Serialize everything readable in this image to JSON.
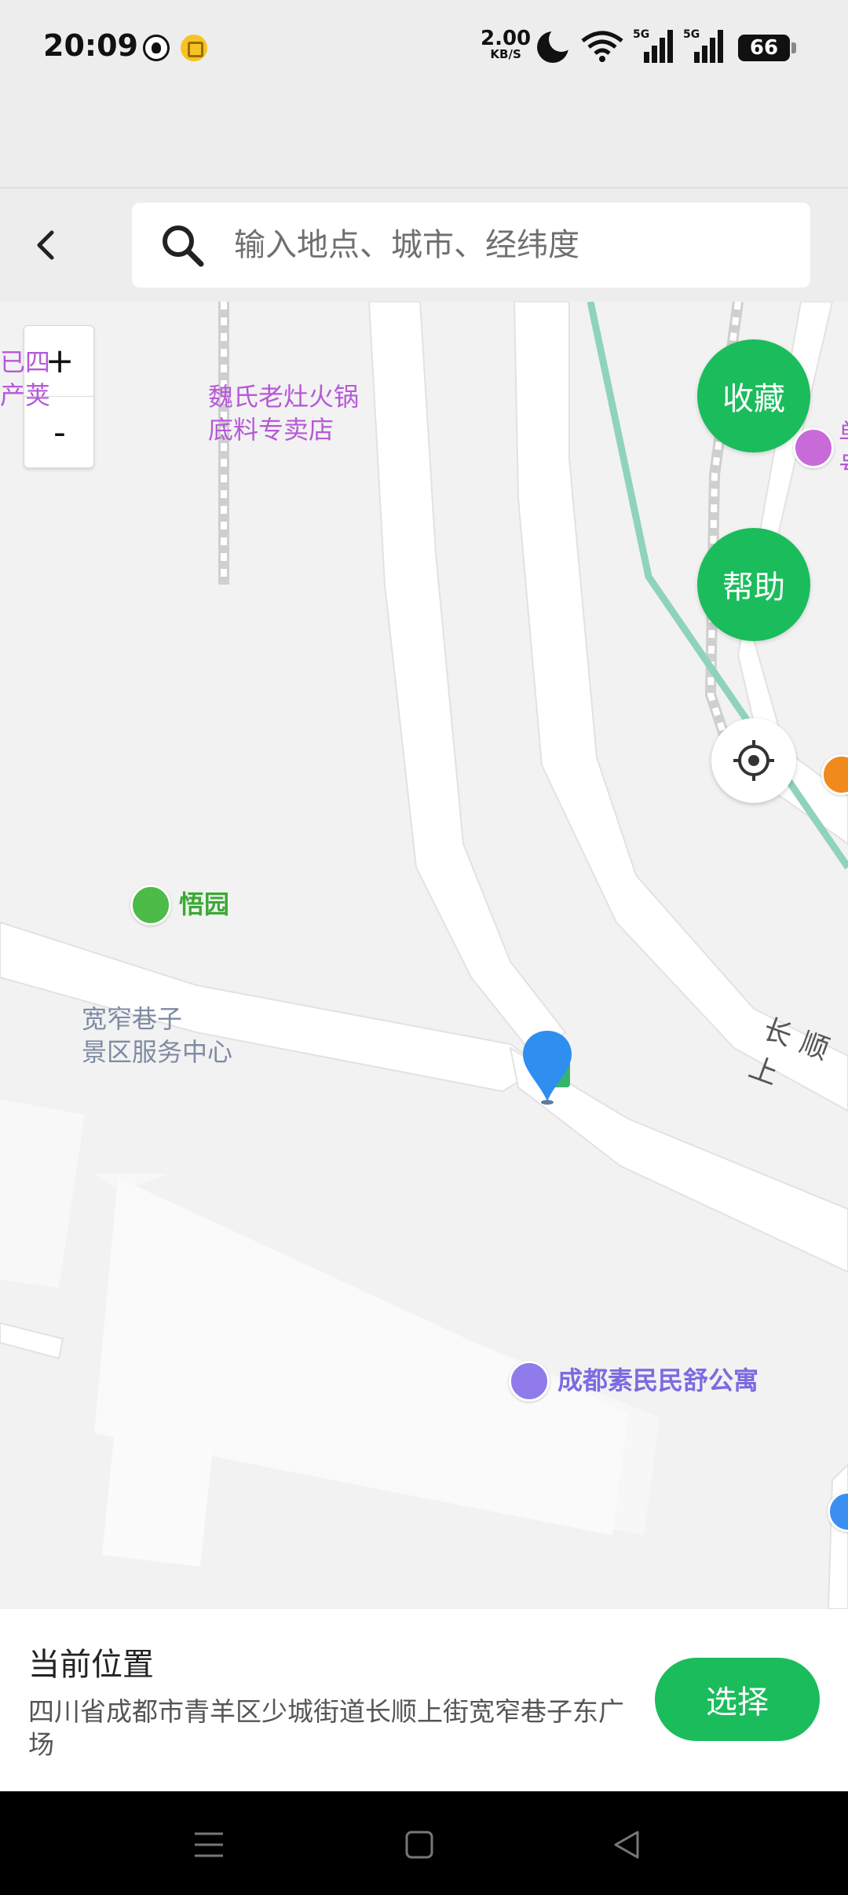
{
  "status_bar": {
    "time": "20:09",
    "net_speed_value": "2.00",
    "net_speed_unit": "KB/S",
    "signal1_tag": "5G",
    "signal2_tag": "5G",
    "battery": "66",
    "icons": [
      "qq-icon",
      "notification-icon",
      "moon-icon",
      "wifi-icon",
      "signal-icon",
      "battery-icon"
    ]
  },
  "header": {
    "search_placeholder": "输入地点、城市、经纬度",
    "icons": [
      "back-arrow-icon",
      "search-icon"
    ]
  },
  "map": {
    "zoom_in_label": "+",
    "zoom_out_label": "-",
    "favorite_label": "收藏",
    "help_label": "帮助",
    "pois": {
      "weishi": "魏氏老灶火锅\n底料专卖店",
      "wuyuan": "悟园",
      "kuanzhai": "宽窄巷子\n景区服务中心",
      "apartment": "成都素民民舒公寓",
      "left_edge_1": "已四",
      "left_edge_2": "产荚",
      "right_edge_1": "单",
      "right_edge_2": "号"
    },
    "street": "长顺上",
    "colors": {
      "accent_green": "#1bbc5c",
      "pin_blue": "#2e8ff0",
      "poi_purple": "#b659d8",
      "poi_green": "#3aaa35",
      "rail_green": "#8fd3bd"
    }
  },
  "bottom_panel": {
    "title": "当前位置",
    "address": "四川省成都市青羊区少城街道长顺上街宽窄巷子东广场",
    "select_label": "选择"
  },
  "nav_bar": {
    "icons": [
      "menu-icon",
      "home-icon",
      "back-icon"
    ]
  }
}
